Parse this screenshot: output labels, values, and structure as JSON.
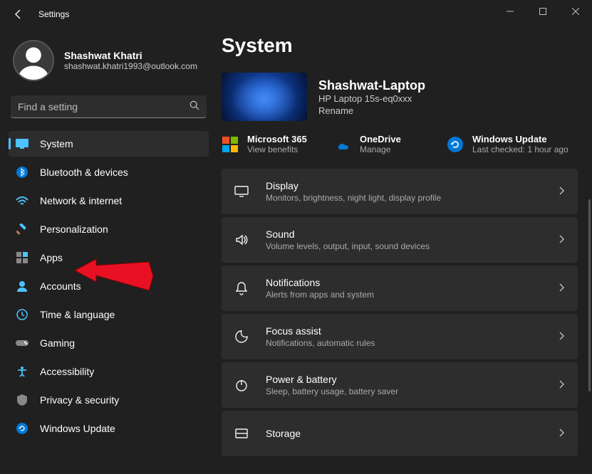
{
  "window": {
    "title": "Settings"
  },
  "profile": {
    "name": "Shashwat Khatri",
    "email": "shashwat.khatri1993@outlook.com"
  },
  "search": {
    "placeholder": "Find a setting"
  },
  "nav": [
    {
      "label": "System",
      "icon": "system",
      "selected": true
    },
    {
      "label": "Bluetooth & devices",
      "icon": "bluetooth"
    },
    {
      "label": "Network & internet",
      "icon": "network"
    },
    {
      "label": "Personalization",
      "icon": "personalization"
    },
    {
      "label": "Apps",
      "icon": "apps"
    },
    {
      "label": "Accounts",
      "icon": "accounts"
    },
    {
      "label": "Time & language",
      "icon": "time"
    },
    {
      "label": "Gaming",
      "icon": "gaming"
    },
    {
      "label": "Accessibility",
      "icon": "accessibility"
    },
    {
      "label": "Privacy & security",
      "icon": "privacy"
    },
    {
      "label": "Windows Update",
      "icon": "update"
    }
  ],
  "page": {
    "title": "System",
    "device": {
      "name": "Shashwat-Laptop",
      "model": "HP Laptop 15s-eq0xxx",
      "rename": "Rename"
    },
    "quick": [
      {
        "title": "Microsoft 365",
        "sub": "View benefits",
        "icon": "m365"
      },
      {
        "title": "OneDrive",
        "sub": "Manage",
        "icon": "onedrive"
      },
      {
        "title": "Windows Update",
        "sub": "Last checked: 1 hour ago",
        "icon": "update"
      }
    ],
    "rows": [
      {
        "title": "Display",
        "sub": "Monitors, brightness, night light, display profile",
        "icon": "display"
      },
      {
        "title": "Sound",
        "sub": "Volume levels, output, input, sound devices",
        "icon": "sound"
      },
      {
        "title": "Notifications",
        "sub": "Alerts from apps and system",
        "icon": "notifications"
      },
      {
        "title": "Focus assist",
        "sub": "Notifications, automatic rules",
        "icon": "focus"
      },
      {
        "title": "Power & battery",
        "sub": "Sleep, battery usage, battery saver",
        "icon": "power"
      },
      {
        "title": "Storage",
        "sub": "",
        "icon": "storage"
      }
    ]
  }
}
